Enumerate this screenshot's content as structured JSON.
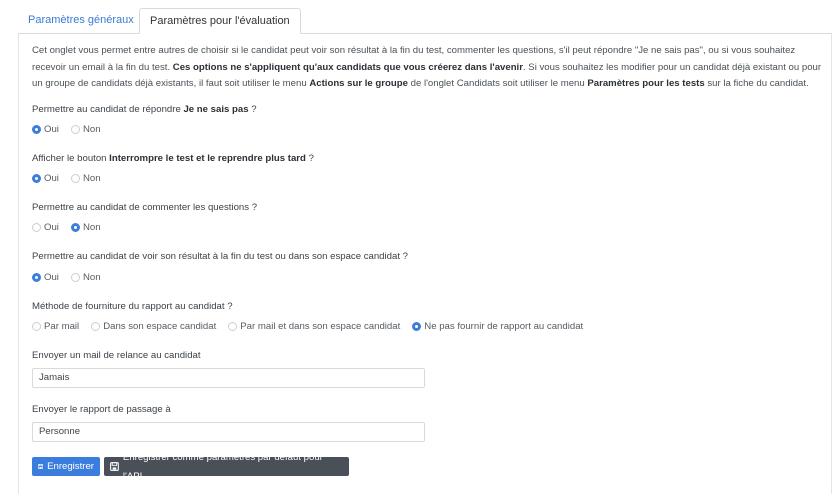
{
  "tabs": [
    {
      "label": "Paramètres généraux"
    },
    {
      "label": "Paramètres pour l'évaluation"
    }
  ],
  "intro": {
    "p1": "Cet onglet vous permet entre autres de choisir si le candidat peut voir son résultat à la fin du test, commenter les questions, s'il peut répondre \"Je ne sais pas\", ou si vous souhaitez recevoir un email à la fin du test. ",
    "b1": "Ces options ne s'appliquent qu'aux candidats que vous créerez dans l'avenir",
    "p2": ". Si vous souhaitez les modifier pour un candidat déjà existant ou pour un groupe de candidats déjà existants, il faut soit utiliser le menu ",
    "b2": "Actions sur le groupe",
    "p3": " de l'onglet Candidats soit utiliser le menu ",
    "b3": "Paramètres pour les tests",
    "p4": " sur la fiche du candidat."
  },
  "questions": {
    "q1": {
      "pre": "Permettre au candidat de répondre ",
      "bold": "Je ne sais pas",
      "post": " ?",
      "yes": "Oui",
      "no": "Non",
      "selected": "Oui"
    },
    "q2": {
      "pre": "Afficher le bouton ",
      "bold": "Interrompre le test et le reprendre plus tard",
      "post": " ?",
      "yes": "Oui",
      "no": "Non",
      "selected": "Oui"
    },
    "q3": {
      "text": "Permettre au candidat de commenter les questions ?",
      "yes": "Oui",
      "no": "Non",
      "selected": "Non"
    },
    "q4": {
      "text": "Permettre au candidat de voir son résultat à la fin du test ou dans son espace candidat ?",
      "yes": "Oui",
      "no": "Non",
      "selected": "Oui"
    },
    "q5": {
      "text": "Méthode de fourniture du rapport au candidat ?",
      "options": [
        "Par mail",
        "Dans son espace candidat",
        "Par mail et dans son espace candidat",
        "Ne pas fournir de rapport au candidat"
      ],
      "selected": "Ne pas fournir de rapport au candidat"
    }
  },
  "reminder": {
    "label": "Envoyer un mail de relance au candidat",
    "value": "Jamais"
  },
  "report": {
    "label": "Envoyer le rapport de passage à",
    "value": "Personne"
  },
  "buttons": {
    "save": "Enregistrer",
    "save_default": "Enregistrer comme paramètres par défaut pour l'API"
  },
  "colors": {
    "accent": "#3b7ddd",
    "dark_button": "#495057",
    "tab_link": "#3a7bd5"
  }
}
